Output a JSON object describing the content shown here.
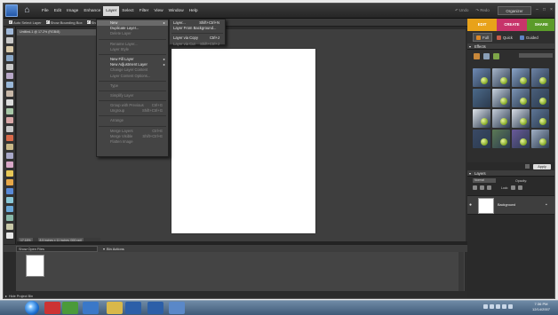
{
  "menubar": {
    "items": [
      "File",
      "Edit",
      "Image",
      "Enhance",
      "Layer",
      "Select",
      "Filter",
      "View",
      "Window",
      "Help"
    ],
    "active": "Layer"
  },
  "history": {
    "undo_label": "Undo",
    "redo_label": "Redo"
  },
  "organizer_label": "Organizer",
  "options_bar": {
    "auto_select": "Auto Select Layer",
    "show_bounding": "Show Bounding Box",
    "show_highlight": "Show"
  },
  "mode_tabs": [
    {
      "label": "EDIT",
      "color": "#e8a21a"
    },
    {
      "label": "CREATE",
      "color": "#c7346a"
    },
    {
      "label": "SHARE",
      "color": "#5b9b2a"
    }
  ],
  "sub_tabs": [
    {
      "label": "Full",
      "icon": "full-edit-icon",
      "color": "#d9882a"
    },
    {
      "label": "Quick",
      "icon": "quick-fix-icon",
      "color": "#c45d4a"
    },
    {
      "label": "Guided",
      "icon": "guided-icon",
      "color": "#5e83c6"
    }
  ],
  "document": {
    "tab_title": "Untitled-1 @ 17.2% (RGB/8)",
    "zoom": "17.16%",
    "status": "8.5 inches x 11 inches (300 ppi)"
  },
  "layer_menu": [
    {
      "label": "New",
      "shortcut": "",
      "submenu": true,
      "disabled": false,
      "highlight": true
    },
    {
      "label": "Duplicate Layer...",
      "shortcut": "",
      "disabled": false
    },
    {
      "label": "Delete Layer",
      "shortcut": "",
      "disabled": true
    },
    {
      "sep": true
    },
    {
      "label": "Rename Layer...",
      "shortcut": "",
      "disabled": true
    },
    {
      "label": "Layer Style",
      "shortcut": "",
      "disabled": true
    },
    {
      "sep": true
    },
    {
      "label": "New Fill Layer",
      "shortcut": "",
      "submenu": true,
      "disabled": false
    },
    {
      "label": "New Adjustment Layer",
      "shortcut": "",
      "submenu": true,
      "disabled": false
    },
    {
      "label": "Change Layer Content",
      "shortcut": "",
      "disabled": true
    },
    {
      "label": "Layer Content Options...",
      "shortcut": "",
      "disabled": true
    },
    {
      "sep": true
    },
    {
      "label": "Type",
      "shortcut": "",
      "disabled": true
    },
    {
      "sep": true
    },
    {
      "label": "Simplify Layer",
      "shortcut": "",
      "disabled": true
    },
    {
      "sep": true
    },
    {
      "label": "Group with Previous",
      "shortcut": "Ctrl+G",
      "disabled": true
    },
    {
      "label": "Ungroup",
      "shortcut": "Shift+Ctrl+G",
      "disabled": true
    },
    {
      "sep": true
    },
    {
      "label": "Arrange",
      "shortcut": "",
      "disabled": true
    },
    {
      "sep": true
    },
    {
      "label": "Merge Layers",
      "shortcut": "Ctrl+E",
      "disabled": true
    },
    {
      "label": "Merge Visible",
      "shortcut": "Shift+Ctrl+E",
      "disabled": true
    },
    {
      "label": "Flatten Image",
      "shortcut": "",
      "disabled": true
    }
  ],
  "new_submenu": [
    {
      "label": "Layer...",
      "shortcut": "Shift+Ctrl+N",
      "disabled": false
    },
    {
      "label": "Layer From Background...",
      "shortcut": "",
      "disabled": false
    },
    {
      "sep": true
    },
    {
      "label": "Layer via Copy",
      "shortcut": "Ctrl+J",
      "disabled": false
    },
    {
      "label": "Layer via Cut",
      "shortcut": "Shift+Ctrl+J",
      "disabled": true
    }
  ],
  "effects_panel": {
    "title": "Effects",
    "apply_label": "Apply"
  },
  "layers_panel": {
    "title": "Layers",
    "blend_mode": "Normal",
    "opacity_label": "Opacity:",
    "lock_label": "Lock:",
    "layer_name": "Background"
  },
  "project_bin": {
    "select": "Show Open Files",
    "actions": "Bin Actions",
    "hide_label": "Hide Project Bin"
  },
  "taskbar": {
    "time": "7:36 PM",
    "date": "12/14/2007"
  },
  "colors": {
    "menu_bg": "#444444",
    "workspace": "#3e3e3e",
    "edit_tab": "#e8a21a",
    "create_tab": "#c7346a",
    "share_tab": "#5b9b2a"
  }
}
